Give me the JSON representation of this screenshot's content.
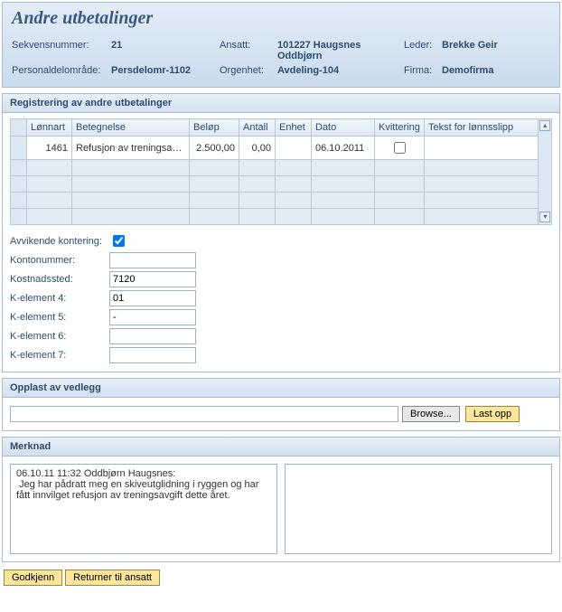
{
  "page": {
    "title": "Andre utbetalinger"
  },
  "info": {
    "sekvensnummer_label": "Sekvensnummer:",
    "sekvensnummer": "21",
    "ansatt_label": "Ansatt:",
    "ansatt": "101227 Haugsnes Oddbjørn",
    "leder_label": "Leder:",
    "leder": "Brekke Geir",
    "persomr_label": "Personaldelområde:",
    "persomr": "Persdelomr-1102",
    "orgenhet_label": "Orgenhet:",
    "orgenhet": "Avdeling-104",
    "firma_label": "Firma:",
    "firma": "Demofirma"
  },
  "reg": {
    "header": "Registrering av andre utbetalinger",
    "columns": {
      "lonnart": "Lønnart",
      "betegnelse": "Betegnelse",
      "belop": "Beløp",
      "antall": "Antall",
      "enhet": "Enhet",
      "dato": "Dato",
      "kvittering": "Kvittering",
      "tekst": "Tekst for lønnsslipp"
    },
    "row": {
      "lonnart": "1461",
      "betegnelse": "Refusjon av treningsavg.",
      "belop": "2.500,00",
      "antall": "0,00",
      "enhet": "",
      "dato": "06.10.2011",
      "kvittering_checked": false,
      "tekst": ""
    },
    "avvikende_label": "Avvikende kontering:",
    "avvikende_checked": true,
    "kontonummer_label": "Kontonummer:",
    "kontonummer": "",
    "kostnadssted_label": "Kostnadssted:",
    "kostnadssted": "7120",
    "k4_label": "K-element 4:",
    "k4": "01",
    "k5_label": "K-element 5:",
    "k5": "-",
    "k6_label": "K-element 6:",
    "k6": "",
    "k7_label": "K-element 7:",
    "k7": ""
  },
  "vedlegg": {
    "header": "Opplast av vedlegg",
    "file_value": "",
    "browse_label": "Browse...",
    "upload_label": "Last opp"
  },
  "merknad": {
    "header": "Merknad",
    "readonly_text": "06.10.11 11:32 Oddbjørn Haugsnes:\n Jeg har pådratt meg en skiveutglidning i ryggen og har fått innvilget refusjon av treningsavgift dette året.",
    "edit_text": ""
  },
  "actions": {
    "approve": "Godkjenn",
    "return": "Returner til ansatt"
  }
}
